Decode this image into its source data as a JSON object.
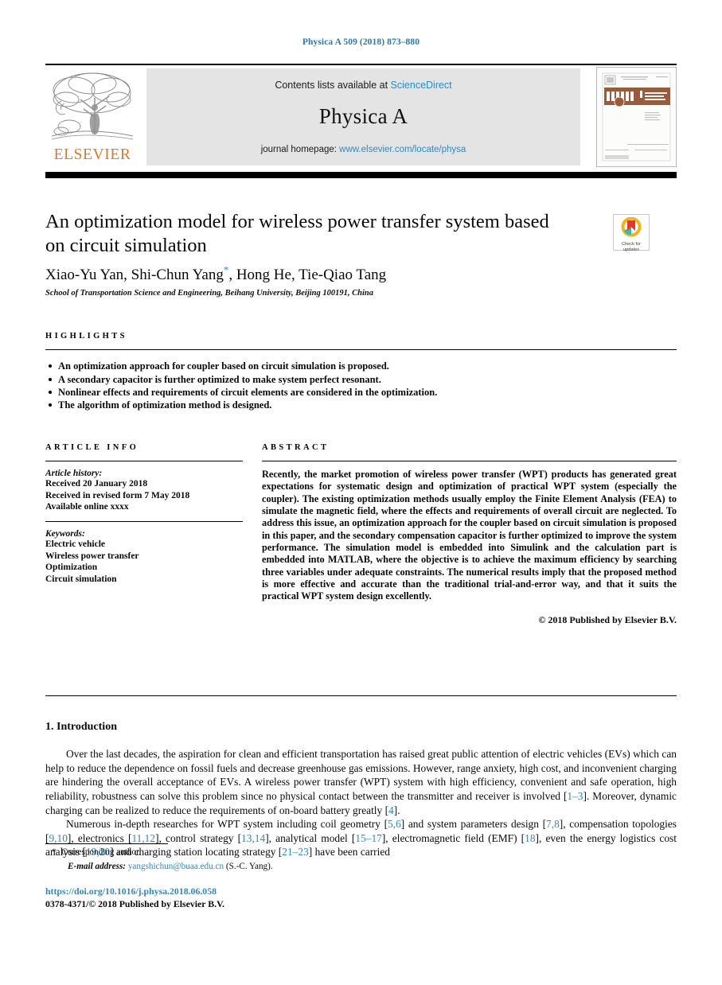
{
  "running_head": "Physica A 509 (2018) 873–880",
  "masthead": {
    "contents_prefix": "Contents lists available at",
    "sciencedirect": "ScienceDirect",
    "journal_name": "Physica A",
    "homepage_prefix": "journal homepage:",
    "homepage_url": "www.elsevier.com/locate/physa",
    "publisher_wordmark": "ELSEVIER",
    "cover_title": "PHYSICA A",
    "cover_subtitle": "STATISTICAL MECHANICS AND ITS APPLICATIONS"
  },
  "article": {
    "title": "An optimization model for wireless power transfer system based on circuit simulation",
    "authors": "Xiao-Yu Yan, Shi-Chun Yang, Hong He, Tie-Qiao Tang",
    "corresponding_marker": "*",
    "affiliation": "School of Transportation Science and Engineering, Beihang University, Beijing  100191, China",
    "crossmark_line1": "Check for",
    "crossmark_line2": "updates"
  },
  "highlights": {
    "heading": "HIGHLIGHTS",
    "items": [
      "An optimization approach for coupler based on circuit simulation is proposed.",
      "A secondary capacitor is further optimized to make system perfect resonant.",
      "Nonlinear effects and requirements of circuit elements are considered in the optimization.",
      "The algorithm of optimization method is designed."
    ]
  },
  "article_info": {
    "heading": "ARTICLE INFO",
    "history_label": "Article history:",
    "history": [
      "Received 20 January 2018",
      "Received in revised form 7 May 2018",
      "Available online xxxx"
    ],
    "keywords_label": "Keywords:",
    "keywords": [
      "Electric vehicle",
      "Wireless power transfer",
      "Optimization",
      "Circuit simulation"
    ]
  },
  "abstract": {
    "heading": "ABSTRACT",
    "text": "Recently, the market promotion of wireless power transfer (WPT) products has generated great expectations for systematic design and optimization of practical WPT system (especially the coupler). The existing optimization methods usually employ the Finite Element Analysis (FEA) to simulate the magnetic field, where the effects and requirements of overall circuit are neglected. To address this issue, an optimization approach for the coupler based on circuit simulation is proposed in this paper, and the secondary compensation capacitor is further optimized to improve the system performance. The simulation model is embedded into Simulink and the calculation part is embedded into MATLAB, where the objective is to achieve the maximum efficiency by searching three variables under adequate constraints. The numerical results imply that the proposed method is more effective and accurate than the traditional trial-and-error way, and that it suits the practical WPT system design excellently.",
    "copyright": "© 2018 Published by Elsevier B.V."
  },
  "introduction": {
    "heading": "1.  Introduction",
    "paragraph_1_part_a": "Over the last decades, the aspiration for clean and efficient transportation has raised great public attention of electric vehicles (EVs) which can help to reduce the dependence on fossil fuels and decrease greenhouse gas emissions. However, range anxiety, high cost, and inconvenient charging are hindering the overall acceptance of EVs. A wireless power transfer (WPT) system with high efficiency, convenient and safe operation, high reliability, robustness can solve this problem since no physical contact between the transmitter and receiver is involved [",
    "cite_1_3": "1–3",
    "paragraph_1_part_b": "]. Moreover, dynamic charging can be realized to reduce the requirements of on-board battery greatly [",
    "cite_4": "4",
    "paragraph_1_part_c": "].",
    "paragraph_2_part_a": "Numerous in-depth researches for WPT system including coil geometry [",
    "cite_5_6": "5,6",
    "paragraph_2_part_b": "] and system parameters design [",
    "cite_7_8": "7,8",
    "paragraph_2_part_c": "], compensation topologies [",
    "cite_9_10": "9,10",
    "paragraph_2_part_d": "], electronics [",
    "cite_11_12": "11,12",
    "paragraph_2_part_e": "], control strategy [",
    "cite_13_14": "13,14",
    "paragraph_2_part_f": "], analytical model [",
    "cite_15_17": "15–17",
    "paragraph_2_part_g": "], electromagnetic field (EMF) [",
    "cite_18": "18",
    "paragraph_2_part_h": "], even the energy logistics cost analysis [",
    "cite_19_20": "19,20",
    "paragraph_2_part_i": "] and charging station locating strategy [",
    "cite_21_23": "21–23",
    "paragraph_2_part_j": "] have been carried"
  },
  "footer": {
    "star": "*",
    "corresponding_author": "Corresponding author.",
    "email_label": "E-mail address:",
    "email": "yangshichun@buaa.edu.cn",
    "email_suffix": "(S.-C. Yang).",
    "doi": "https://doi.org/10.1016/j.physa.2018.06.058",
    "issn_line": "0378-4371/© 2018 Published by Elsevier B.V."
  },
  "colors": {
    "link_blue": "#2b8bc4",
    "elsevier_orange": "#e87422",
    "masthead_grey": "#e4e4e4",
    "cover_brown": "#9c5a3c"
  }
}
